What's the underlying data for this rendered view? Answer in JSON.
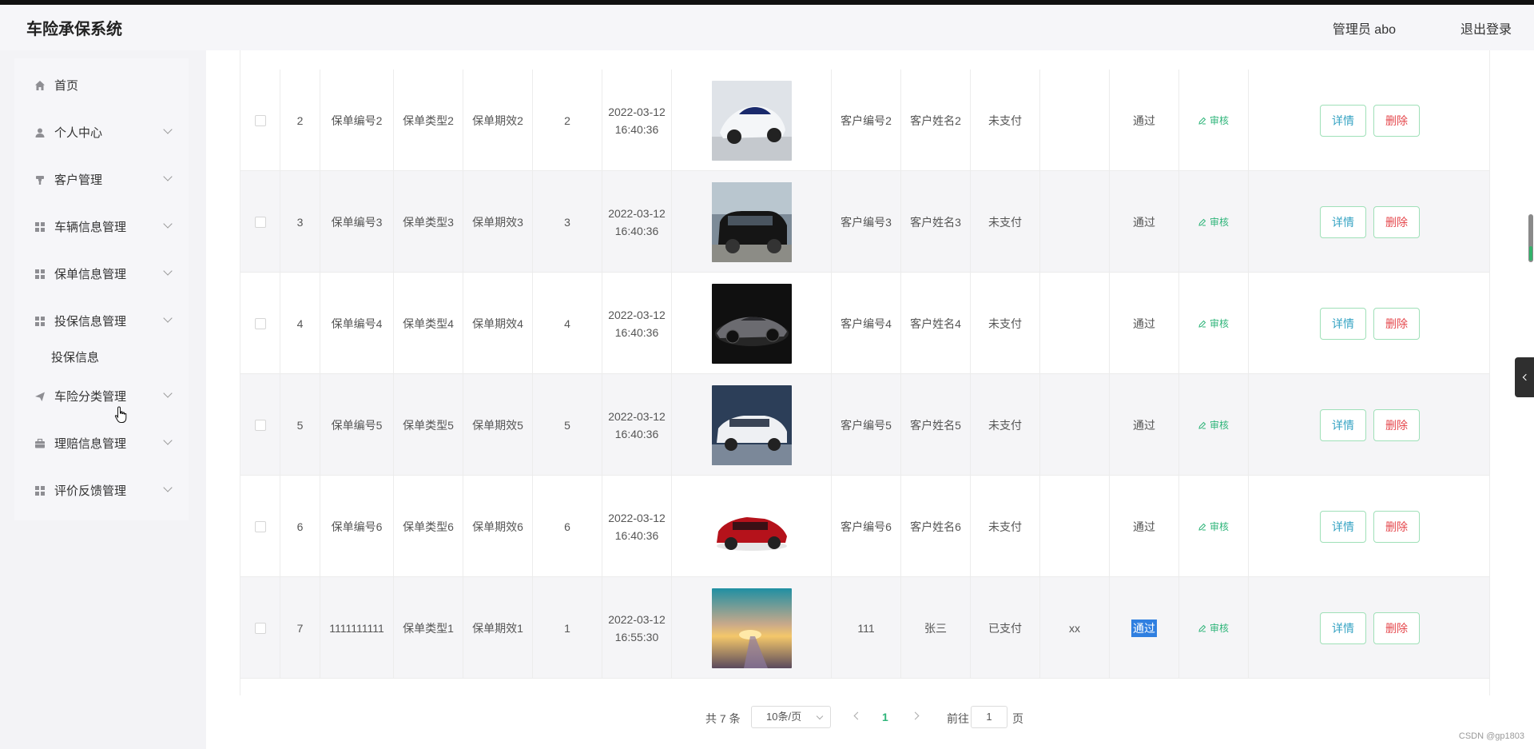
{
  "header": {
    "app_title": "车险承保系统",
    "admin": "管理员 abo",
    "logout": "退出登录"
  },
  "sidebar": {
    "items": [
      {
        "label": "首页",
        "icon": "home-icon",
        "has_children": false
      },
      {
        "label": "个人中心",
        "icon": "user-icon",
        "has_children": true
      },
      {
        "label": "客户管理",
        "icon": "customer-icon",
        "has_children": true
      },
      {
        "label": "车辆信息管理",
        "icon": "grid-icon",
        "has_children": true
      },
      {
        "label": "保单信息管理",
        "icon": "grid-icon",
        "has_children": true
      },
      {
        "label": "投保信息管理",
        "icon": "grid-icon",
        "has_children": true,
        "expanded": true,
        "children": [
          "投保信息"
        ]
      },
      {
        "label": "车险分类管理",
        "icon": "send-icon",
        "has_children": true
      },
      {
        "label": "理赔信息管理",
        "icon": "briefcase-icon",
        "has_children": true
      },
      {
        "label": "评价反馈管理",
        "icon": "grid-icon",
        "has_children": true
      }
    ]
  },
  "table": {
    "partial_row": {
      "time_tail": "36"
    },
    "rows": [
      {
        "index": "2",
        "policy_no": "保单编号2",
        "policy_type": "保单类型2",
        "policy_term": "保单期效2",
        "qty": "2",
        "time": "2022-03-12 16:40:36",
        "customer_no": "客户编号2",
        "customer_name": "客户姓名2",
        "pay_status": "未支付",
        "remark": "",
        "audit_result": "通过",
        "image": "white-concept-car"
      },
      {
        "index": "3",
        "policy_no": "保单编号3",
        "policy_type": "保单类型3",
        "policy_term": "保单期效3",
        "qty": "3",
        "time": "2022-03-12 16:40:36",
        "customer_no": "客户编号3",
        "customer_name": "客户姓名3",
        "pay_status": "未支付",
        "remark": "",
        "audit_result": "通过",
        "image": "black-suv"
      },
      {
        "index": "4",
        "policy_no": "保单编号4",
        "policy_type": "保单类型4",
        "policy_term": "保单期效4",
        "qty": "4",
        "time": "2022-03-12 16:40:36",
        "customer_no": "客户编号4",
        "customer_name": "客户姓名4",
        "pay_status": "未支付",
        "remark": "",
        "audit_result": "通过",
        "image": "dark-roadster"
      },
      {
        "index": "5",
        "policy_no": "保单编号5",
        "policy_type": "保单类型5",
        "policy_term": "保单期效5",
        "qty": "5",
        "time": "2022-03-12 16:40:36",
        "customer_no": "客户编号5",
        "customer_name": "客户姓名5",
        "pay_status": "未支付",
        "remark": "",
        "audit_result": "通过",
        "image": "white-sedan"
      },
      {
        "index": "6",
        "policy_no": "保单编号6",
        "policy_type": "保单类型6",
        "policy_term": "保单期效6",
        "qty": "6",
        "time": "2022-03-12 16:40:36",
        "customer_no": "客户编号6",
        "customer_name": "客户姓名6",
        "pay_status": "未支付",
        "remark": "",
        "audit_result": "通过",
        "image": "red-sedan"
      },
      {
        "index": "7",
        "policy_no": "1111111111",
        "policy_type": "保单类型1",
        "policy_term": "保单期效1",
        "qty": "1",
        "time": "2022-03-12 16:55:30",
        "customer_no": "111",
        "customer_name": "张三",
        "pay_status": "已支付",
        "remark": "xx",
        "audit_result": "通过",
        "image": "sunset-road",
        "highlighted": true
      }
    ],
    "audit_link": "审核",
    "detail_button": "详情",
    "delete_button": "删除"
  },
  "pager": {
    "total": "共 7 条",
    "page_size": "10条/页",
    "current_page": "1",
    "goto_label": "前往",
    "goto_value": "1",
    "page_unit": "页"
  },
  "watermark": "CSDN @gp1803",
  "colors": {
    "accent_green": "#2fb57a",
    "detail_blue": "#36a3c3",
    "delete_red": "#e5484d",
    "button_border": "#9fe0b8",
    "highlight": "#2f7fe0"
  }
}
